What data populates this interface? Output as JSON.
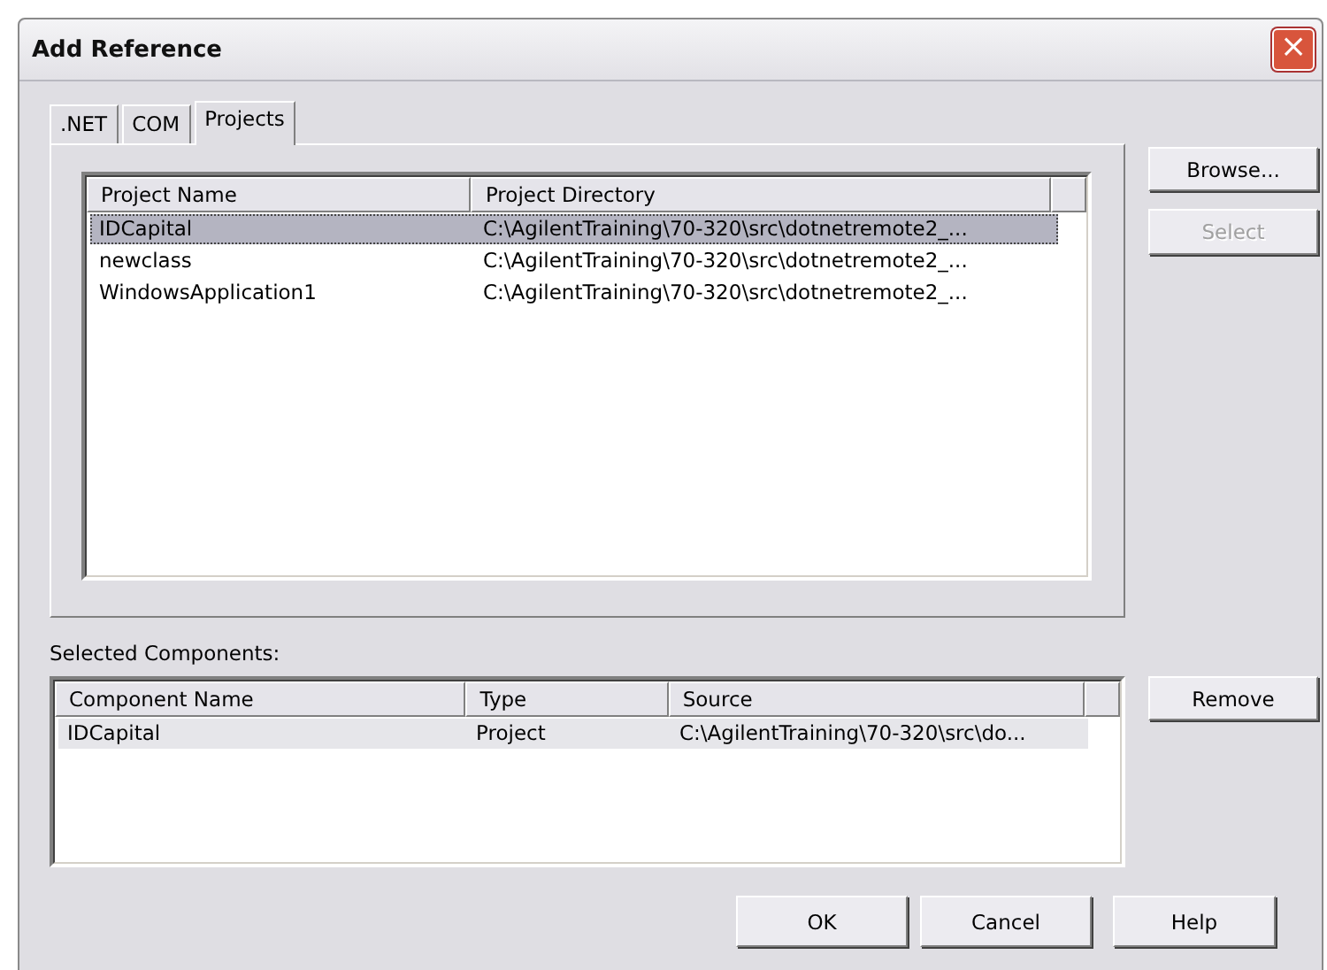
{
  "window": {
    "title": "Add Reference",
    "close": "×"
  },
  "tabs": [
    {
      "label": ".NET",
      "selected": false
    },
    {
      "label": "COM",
      "selected": false
    },
    {
      "label": "Projects",
      "selected": true
    }
  ],
  "projects": {
    "columns": [
      "Project Name",
      "Project Directory"
    ],
    "rows": [
      {
        "cells": [
          "IDCapital",
          "C:\\AgilentTraining\\70-320\\src\\dotnetremote2_..."
        ],
        "selected": true
      },
      {
        "cells": [
          "newclass",
          "C:\\AgilentTraining\\70-320\\src\\dotnetremote2_..."
        ],
        "selected": false
      },
      {
        "cells": [
          "WindowsApplication1",
          "C:\\AgilentTraining\\70-320\\src\\dotnetremote2_..."
        ],
        "selected": false
      }
    ]
  },
  "side_buttons": [
    {
      "label": "Browse...",
      "disabled": false
    },
    {
      "label": "Select",
      "disabled": true
    }
  ],
  "selected_components": {
    "label": "Selected Components:",
    "columns": [
      "Component Name",
      "Type",
      "Source"
    ],
    "rows": [
      {
        "cells": [
          "IDCapital",
          "Project",
          "C:\\AgilentTraining\\70-320\\src\\do..."
        ],
        "selected": true
      }
    ]
  },
  "remove_button": {
    "label": "Remove",
    "disabled": false
  },
  "buttons": [
    {
      "label": "OK",
      "disabled": false
    },
    {
      "label": "Cancel",
      "disabled": false
    },
    {
      "label": "Help",
      "disabled": false
    }
  ]
}
